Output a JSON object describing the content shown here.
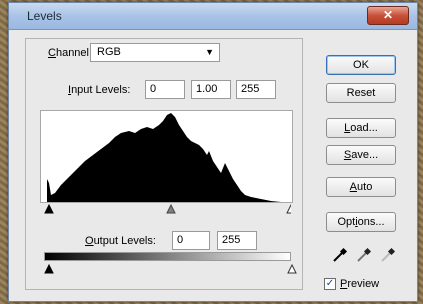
{
  "window": {
    "title": "Levels",
    "close_glyph": "✕"
  },
  "channel": {
    "label_prefix": "",
    "label_u": "C",
    "label_rest": "hannel:",
    "value": "RGB"
  },
  "input_levels": {
    "label_u": "I",
    "label_rest": "nput Levels:",
    "black": "0",
    "gamma": "1.00",
    "white": "255"
  },
  "output_levels": {
    "label_u": "O",
    "label_rest": "utput Levels:",
    "black": "0",
    "white": "255"
  },
  "buttons": {
    "ok": "OK",
    "reset": "Reset",
    "load_u": "L",
    "load_rest": "oad...",
    "save_u": "S",
    "save_rest": "ave...",
    "auto_u": "A",
    "auto_rest": "uto",
    "options_pre": "Opt",
    "options_u": "i",
    "options_rest": "ons..."
  },
  "preview": {
    "checked": "✓",
    "label_u": "P",
    "label_rest": "review"
  },
  "icons": [
    "black-eyedropper-icon",
    "gray-eyedropper-icon",
    "white-eyedropper-icon"
  ]
}
